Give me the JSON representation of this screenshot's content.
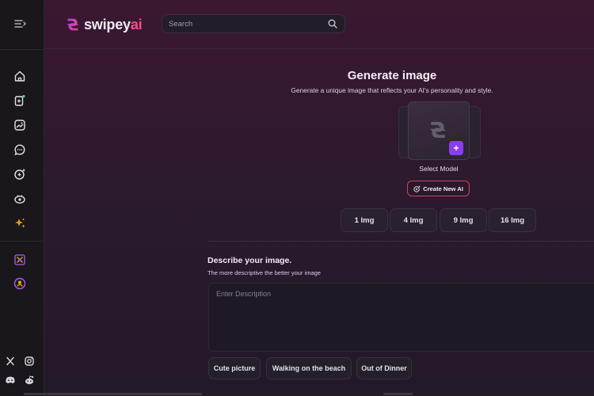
{
  "brand": {
    "word": "swipey",
    "suffix": "ai",
    "accent": "#ff4d8d",
    "gradient_start": "#a83cf0"
  },
  "search": {
    "placeholder": "Search"
  },
  "sidebar": {
    "icons": [
      "collapse-menu-icon",
      "home-icon",
      "stack-add-icon",
      "gallery-icon",
      "chat-icon",
      "create-ai-icon",
      "explore-icon",
      "sparkle-icon",
      "premium-icon",
      "profile-icon"
    ],
    "socials": [
      "x-icon",
      "instagram-icon",
      "discord-icon",
      "reddit-icon"
    ]
  },
  "generate": {
    "title": "Generate image",
    "subtitle": "Generate a unique image that reflects your AI's personality and style.",
    "select_model": "Select Model",
    "add_symbol": "+",
    "create_new_ai": "Create New AI",
    "counts": [
      "1 Img",
      "4 Img",
      "9 Img",
      "16 Img"
    ]
  },
  "describe": {
    "title": "Describe your image.",
    "subtitle": "The more descriptive the better your image",
    "placeholder": "Enter Description",
    "suggestions": [
      "Cute picture",
      "Walking on the beach",
      "Out of Dinner"
    ]
  },
  "colors": {
    "primary_button": "#8a3df0",
    "outline_button": "#d63b6f",
    "sidebar_highlight": "#e8a317"
  }
}
